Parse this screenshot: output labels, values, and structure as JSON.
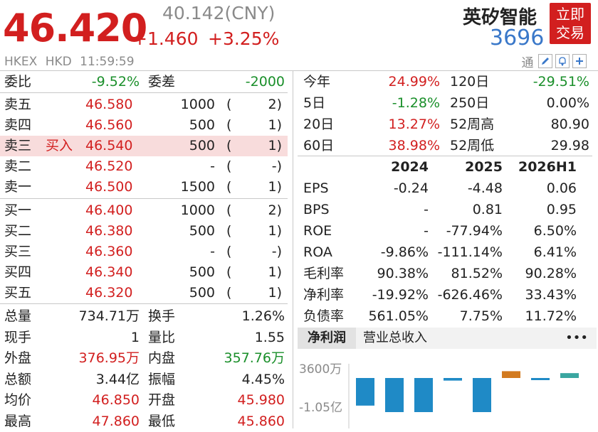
{
  "quote": {
    "price": "46.420",
    "cny_price": "40.142(CNY)",
    "change": "+1.460",
    "change_pct": "+3.25%",
    "name": "英矽智能",
    "code": "3696",
    "trade_label_1": "立即",
    "trade_label_2": "交易",
    "exchange": "HKEX",
    "currency": "HKD",
    "time": "11:59:59",
    "tong": "通"
  },
  "icons": [
    "edit-icon",
    "bell-icon",
    "plus-icon"
  ],
  "colors": {
    "up": "#d21f1f",
    "down": "#1a8f2a",
    "accent": "#3a78c9",
    "bar_blue": "#1f8ac6",
    "bar_orange": "#d27a1f",
    "bar_teal": "#3aa6a0"
  },
  "order_book": {
    "ratio_label": "委比",
    "ratio_value": "-9.52%",
    "diff_label": "委差",
    "diff_value": "-2000",
    "asks": [
      {
        "label": "卖五",
        "extra": "",
        "price": "46.580",
        "volume": "1000",
        "open": "(",
        "count": "2)"
      },
      {
        "label": "卖四",
        "extra": "",
        "price": "46.560",
        "volume": "500",
        "open": "(",
        "count": "1)"
      },
      {
        "label": "卖三",
        "extra": "买入",
        "price": "46.540",
        "volume": "500",
        "open": "(",
        "count": "1)"
      },
      {
        "label": "卖二",
        "extra": "",
        "price": "46.520",
        "volume": "-",
        "open": "(",
        "count": "-)"
      },
      {
        "label": "卖一",
        "extra": "",
        "price": "46.500",
        "volume": "1500",
        "open": "(",
        "count": "1)"
      }
    ],
    "bids": [
      {
        "label": "买一",
        "price": "46.400",
        "volume": "1000",
        "open": "(",
        "count": "2)"
      },
      {
        "label": "买二",
        "price": "46.380",
        "volume": "500",
        "open": "(",
        "count": "1)"
      },
      {
        "label": "买三",
        "price": "46.360",
        "volume": "-",
        "open": "(",
        "count": "-)"
      },
      {
        "label": "买四",
        "price": "46.340",
        "volume": "500",
        "open": "(",
        "count": "1)"
      },
      {
        "label": "买五",
        "price": "46.320",
        "volume": "500",
        "open": "(",
        "count": "1)"
      }
    ]
  },
  "stats": [
    {
      "l1": "总量",
      "v1": "734.71万",
      "c1": "",
      "l2": "换手",
      "v2": "1.26%",
      "c2": ""
    },
    {
      "l1": "现手",
      "v1": "1",
      "c1": "",
      "l2": "量比",
      "v2": "1.55",
      "c2": ""
    },
    {
      "l1": "外盘",
      "v1": "376.95万",
      "c1": "red",
      "l2": "内盘",
      "v2": "357.76万",
      "c2": "green"
    },
    {
      "l1": "总额",
      "v1": "3.44亿",
      "c1": "",
      "l2": "振幅",
      "v2": "4.45%",
      "c2": ""
    },
    {
      "l1": "均价",
      "v1": "46.850",
      "c1": "red",
      "l2": "开盘",
      "v2": "45.980",
      "c2": "red"
    },
    {
      "l1": "最高",
      "v1": "47.860",
      "c1": "red",
      "l2": "最低",
      "v2": "45.860",
      "c2": "red"
    }
  ],
  "performance": [
    {
      "l1": "今年",
      "v1": "24.99%",
      "c1": "red",
      "l2": "120日",
      "v2": "-29.51%",
      "c2": "green"
    },
    {
      "l1": "5日",
      "v1": "-1.28%",
      "c1": "green",
      "l2": "250日",
      "v2": "0.00%",
      "c2": ""
    },
    {
      "l1": "20日",
      "v1": "13.27%",
      "c1": "red",
      "l2": "52周高",
      "v2": "80.90",
      "c2": ""
    },
    {
      "l1": "60日",
      "v1": "38.98%",
      "c1": "red",
      "l2": "52周低",
      "v2": "29.98",
      "c2": ""
    }
  ],
  "financials": {
    "headers": [
      "2024",
      "2025",
      "2026H1"
    ],
    "rows": [
      {
        "label": "EPS",
        "values": [
          "-0.24",
          "-4.48",
          "0.06"
        ]
      },
      {
        "label": "BPS",
        "values": [
          "-",
          "0.81",
          "0.95"
        ]
      },
      {
        "label": "ROE",
        "values": [
          "-",
          "-77.94%",
          "6.50%"
        ]
      },
      {
        "label": "ROA",
        "values": [
          "-9.86%",
          "-111.14%",
          "6.41%"
        ]
      },
      {
        "label": "毛利率",
        "values": [
          "90.38%",
          "81.52%",
          "90.28%"
        ]
      },
      {
        "label": "净利率",
        "values": [
          "-19.92%",
          "-626.46%",
          "33.43%"
        ]
      },
      {
        "label": "负债率",
        "values": [
          "561.05%",
          "7.75%",
          "11.72%"
        ]
      }
    ]
  },
  "tabs": {
    "active": "净利润",
    "other": "营业总收入",
    "more": "•••"
  },
  "chart_data": {
    "type": "bar",
    "y_tick_labels": [
      "3600万",
      "-1.05亿"
    ],
    "values": [
      -85000000,
      -105000000,
      -105000000,
      -8000000,
      -105000000,
      21000000,
      -4000000,
      15000000
    ],
    "colors": [
      "#1f8ac6",
      "#1f8ac6",
      "#1f8ac6",
      "#1f8ac6",
      "#1f8ac6",
      "#d27a1f",
      "#1f8ac6",
      "#3aa6a0"
    ]
  }
}
